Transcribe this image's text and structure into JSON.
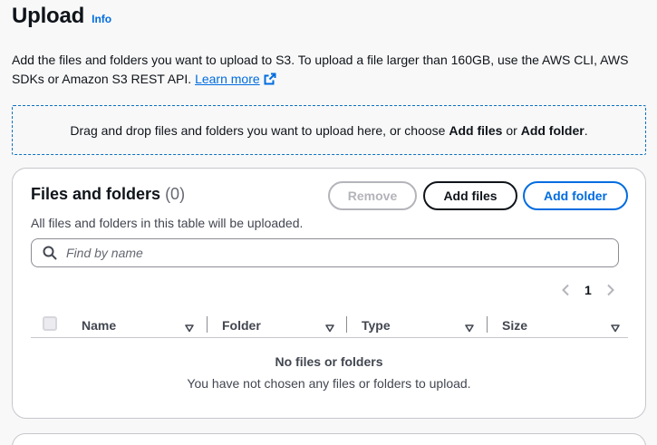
{
  "page": {
    "title": "Upload",
    "info_label": "Info",
    "description": "Add the files and folders you want to upload to S3. To upload a file larger than 160GB, use the AWS CLI, AWS SDKs or Amazon S3 REST API.",
    "learn_more_label": "Learn more"
  },
  "dropzone": {
    "text_prefix": "Drag and drop files and folders you want to upload here, or choose ",
    "add_files_label": "Add files",
    "text_middle": " or ",
    "add_folder_label": "Add folder",
    "text_suffix": "."
  },
  "files_panel": {
    "title": "Files and folders",
    "count": "(0)",
    "subtitle": "All files and folders in this table will be uploaded.",
    "buttons": {
      "remove": "Remove",
      "add_files": "Add files",
      "add_folder": "Add folder"
    },
    "search": {
      "placeholder": "Find by name"
    },
    "pagination": {
      "current_page": "1"
    },
    "columns": [
      {
        "label": "Name"
      },
      {
        "label": "Folder"
      },
      {
        "label": "Type"
      },
      {
        "label": "Size"
      }
    ],
    "empty_state": {
      "title": "No files or folders",
      "message": "You have not chosen any files or folders to upload."
    }
  },
  "colors": {
    "link": "#006ce0",
    "text": "#0f141a",
    "border": "#c6c6cd",
    "disabled": "#b4b4bb"
  },
  "icons": {
    "external_link": "external-link-icon",
    "search": "search-icon",
    "pagination_prev": "chevron-left-icon",
    "pagination_next": "chevron-right-icon",
    "sort": "caret-down-icon"
  }
}
